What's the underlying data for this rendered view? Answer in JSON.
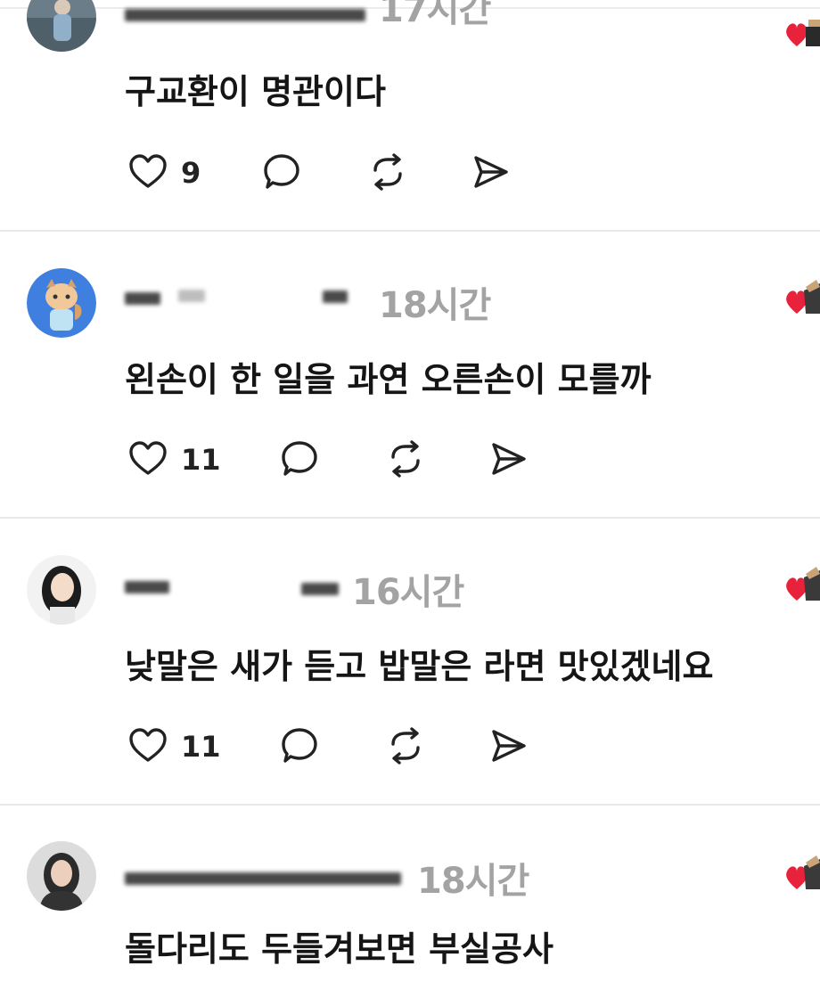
{
  "posts": [
    {
      "time": "17시간",
      "text": "구교환이 명관이다",
      "likes": "9",
      "actions": {
        "like": "heart-icon",
        "reply": "reply-bubble-icon",
        "repost": "repost-icon",
        "share": "send-icon"
      }
    },
    {
      "time": "18시간",
      "text": "왼손이 한 일을 과연 오른손이 모를까",
      "likes": "11",
      "actions": {
        "like": "heart-icon",
        "reply": "reply-bubble-icon",
        "repost": "repost-icon",
        "share": "send-icon"
      }
    },
    {
      "time": "16시간",
      "text": "낮말은 새가 듣고 밥말은 라면 맛있겠네요",
      "likes": "11",
      "actions": {
        "like": "heart-icon",
        "reply": "reply-bubble-icon",
        "repost": "repost-icon",
        "share": "send-icon"
      }
    },
    {
      "time": "18시간",
      "text": "돌다리도 두들겨보면 부실공사"
    }
  ],
  "colors": {
    "time": "#a3a3a3",
    "text": "#151515",
    "reaction_heart": "#e8223a",
    "divider": "#e8e8e8"
  }
}
